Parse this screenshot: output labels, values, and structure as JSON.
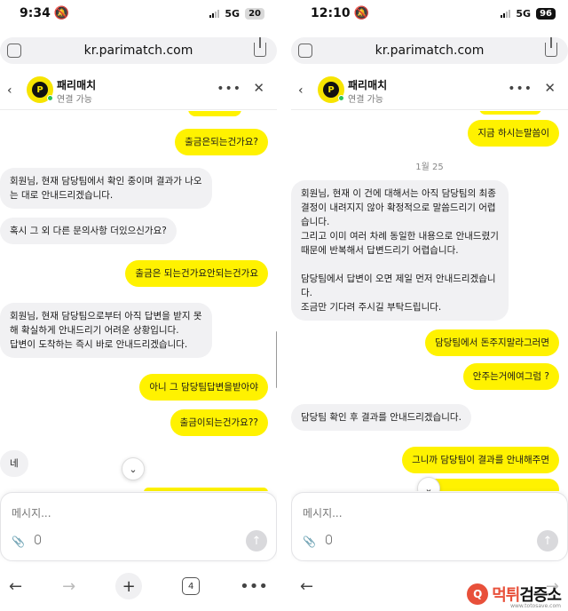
{
  "left": {
    "status": {
      "time": "9:34",
      "network": "5G",
      "battery": "20"
    },
    "url": "kr.parimatch.com",
    "chat": {
      "name": "패리매치",
      "status": "연결 가능"
    },
    "messages": [
      {
        "dir": "out",
        "text": "출금은되는건가요?"
      },
      {
        "dir": "in",
        "text": "회원님, 현재 담당팀에서 확인 중이며 결과가 나오\n는 대로 안내드리겠습니다."
      },
      {
        "dir": "in",
        "text": "혹시 그 외 다른 문의사항 더있으신가요?"
      },
      {
        "dir": "out",
        "text": "출금은 되는건가요안되는건가요"
      },
      {
        "dir": "in",
        "text": "회원님, 현재 담당팀으로부터 아직 답변을 받지 못\n해 확실하게 안내드리기 어려운 상황입니다.\n답변이 도착하는 즉시 바로 안내드리겠습니다."
      },
      {
        "dir": "out",
        "text": "아니 그 담당팀답변을받아야"
      },
      {
        "dir": "out",
        "text": "출금이되는건가요??"
      },
      {
        "dir": "in",
        "text": "네"
      }
    ],
    "composer_placeholder": "메시지...",
    "tab_count": "4"
  },
  "right": {
    "status": {
      "time": "12:10",
      "network": "5G",
      "battery": "96"
    },
    "url": "kr.parimatch.com",
    "chat": {
      "name": "패리매치",
      "status": "연결 가능"
    },
    "messages": [
      {
        "dir": "out",
        "text": "지금 하시는말씀이"
      },
      {
        "dir": "in",
        "text": "회원님, 현재 이 건에 대해서는 아직 담당팀의 최종\n결정이 내려지지 않아 확정적으로 말씀드리기 어렵\n습니다.\n그리고 이미 여러 차례 동일한 내용으로 안내드렸기\n때문에 반복해서 답변드리기 어렵습니다.\n\n담당팀에서 답변이 오면 제일 먼저 안내드리겠습니\n다.\n조금만 기다려 주시길 부탁드립니다."
      },
      {
        "dir": "out",
        "text": "담당팀에서 돈주지말라그러면"
      },
      {
        "dir": "out",
        "text": "안주는거에여그럼 ?"
      },
      {
        "dir": "in",
        "text": "담당팀 확인 후 결과를 안내드리겠습니다."
      },
      {
        "dir": "out",
        "text": "그니까 담당팀이 결과를 안내해주면"
      }
    ],
    "day_separator": "1월 25",
    "composer_placeholder": "메시지..."
  },
  "watermark": {
    "brand_a": "먹튀",
    "brand_b": "검증소",
    "sub": "www.totosave.com"
  },
  "colors": {
    "outgoing": "#fff200",
    "incoming": "#f1f1f3",
    "brand": "#f7e400",
    "watermark": "#e8503a"
  }
}
